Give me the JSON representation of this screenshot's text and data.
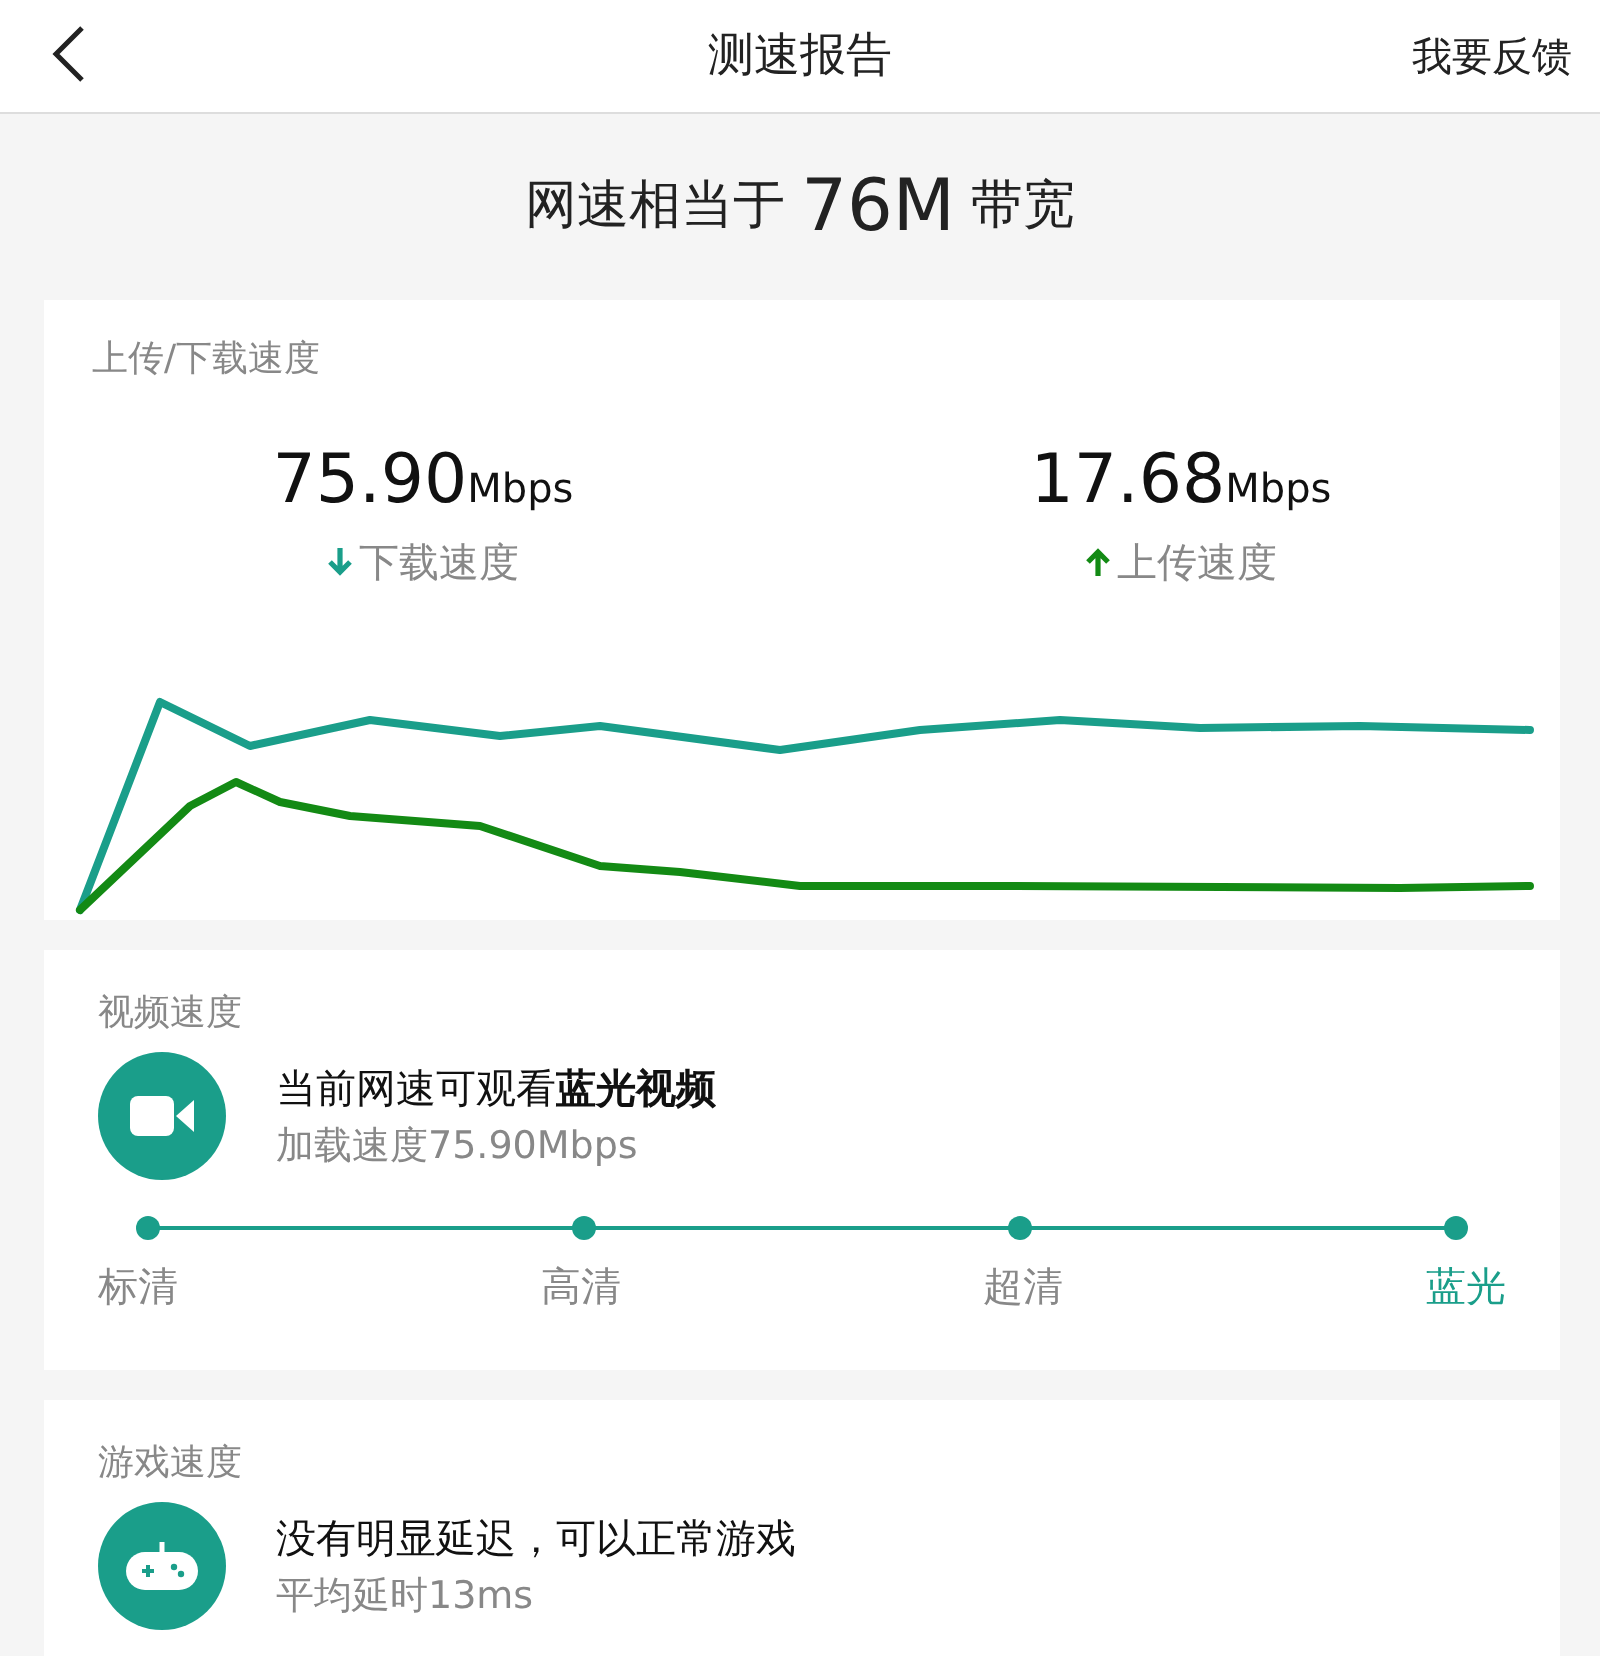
{
  "header": {
    "title": "测速报告",
    "feedback": "我要反馈"
  },
  "summary": {
    "prefix": "网速相当于",
    "value": "76M",
    "suffix": "带宽"
  },
  "speed_card": {
    "title": "上传/下载速度",
    "items": [
      {
        "kind": "download",
        "value": "75.90",
        "unit": "Mbps",
        "label": "下载速度",
        "color": "#1a9e8a"
      },
      {
        "kind": "upload",
        "value": "17.68",
        "unit": "Mbps",
        "label": "上传速度",
        "color": "#138a14"
      }
    ]
  },
  "video_card": {
    "title": "视频速度",
    "kind": "video",
    "headline": "当前网速可观看**蓝光视频**",
    "detail": "加载速度75.90Mbps",
    "levels": [
      {
        "label": "标清",
        "selected": false
      },
      {
        "label": "高清",
        "selected": false
      },
      {
        "label": "超清",
        "selected": false
      },
      {
        "label": "蓝光",
        "selected": true
      }
    ]
  },
  "game_card": {
    "title": "游戏速度",
    "kind": "game",
    "headline": "没有明显延迟，可以正常游戏",
    "detail": "平均延时13ms"
  }
}
